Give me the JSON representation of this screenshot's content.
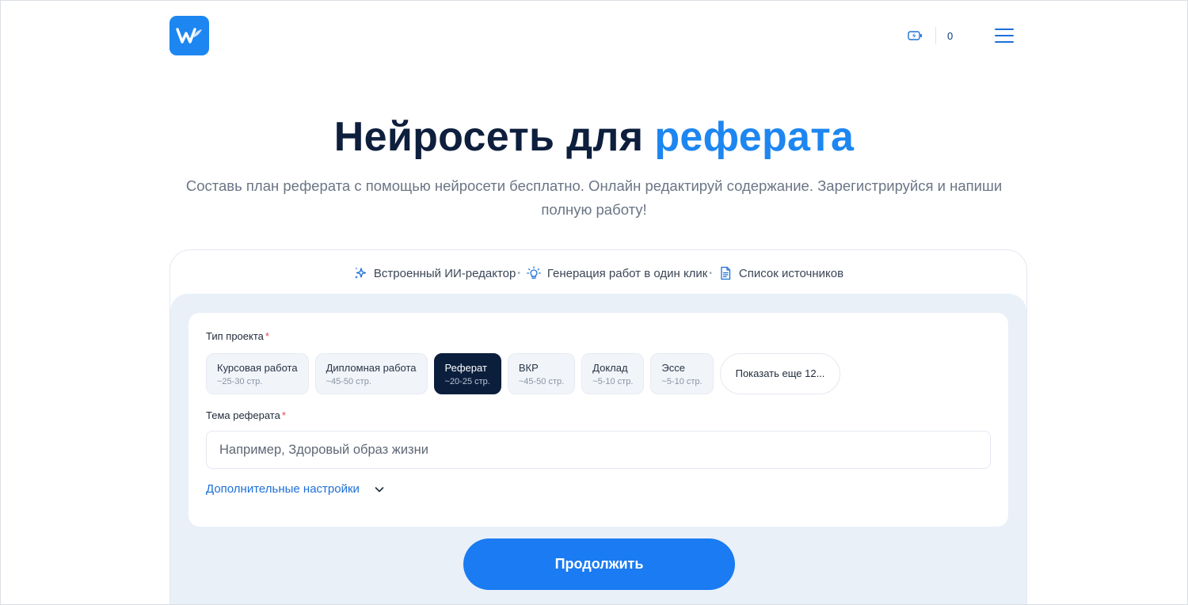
{
  "header": {
    "logo_icon": "w-logo-icon",
    "battery_icon": "battery-charging-icon",
    "credits": "0",
    "menu_icon": "hamburger-menu-icon"
  },
  "hero": {
    "title_main": "Нейросеть для",
    "title_accent": "реферата",
    "subtitle": "Составь план реферата с помощью нейросети бесплатно. Онлайн редактируй содержание. Зарегистрируйся и напиши полную работу!"
  },
  "features": [
    {
      "icon": "sparkles-icon",
      "label": "Встроенный ИИ-редактор"
    },
    {
      "icon": "lightbulb-icon",
      "label": "Генерация работ в один клик"
    },
    {
      "icon": "document-icon",
      "label": "Список источников"
    }
  ],
  "form": {
    "project_type_label": "Тип проекта",
    "required_mark": "*",
    "project_types": [
      {
        "title": "Курсовая работа",
        "pages": "~25-30 стр.",
        "active": false
      },
      {
        "title": "Дипломная работа",
        "pages": "~45-50 стр.",
        "active": false
      },
      {
        "title": "Реферат",
        "pages": "~20-25 стр.",
        "active": true
      },
      {
        "title": "ВКР",
        "pages": "~45-50 стр.",
        "active": false
      },
      {
        "title": "Доклад",
        "pages": "~5-10 стр.",
        "active": false
      },
      {
        "title": "Эссе",
        "pages": "~5-10 стр.",
        "active": false
      }
    ],
    "show_more": "Показать еще 12...",
    "topic_label": "Тема реферата",
    "topic_value": "",
    "topic_placeholder": "Например, Здоровый образ жизни",
    "advanced_settings": "Дополнительные настройки",
    "continue": "Продолжить"
  },
  "colors": {
    "accent": "#1d86f0",
    "dark": "#0b1f3d",
    "button": "#1a7bf2"
  }
}
